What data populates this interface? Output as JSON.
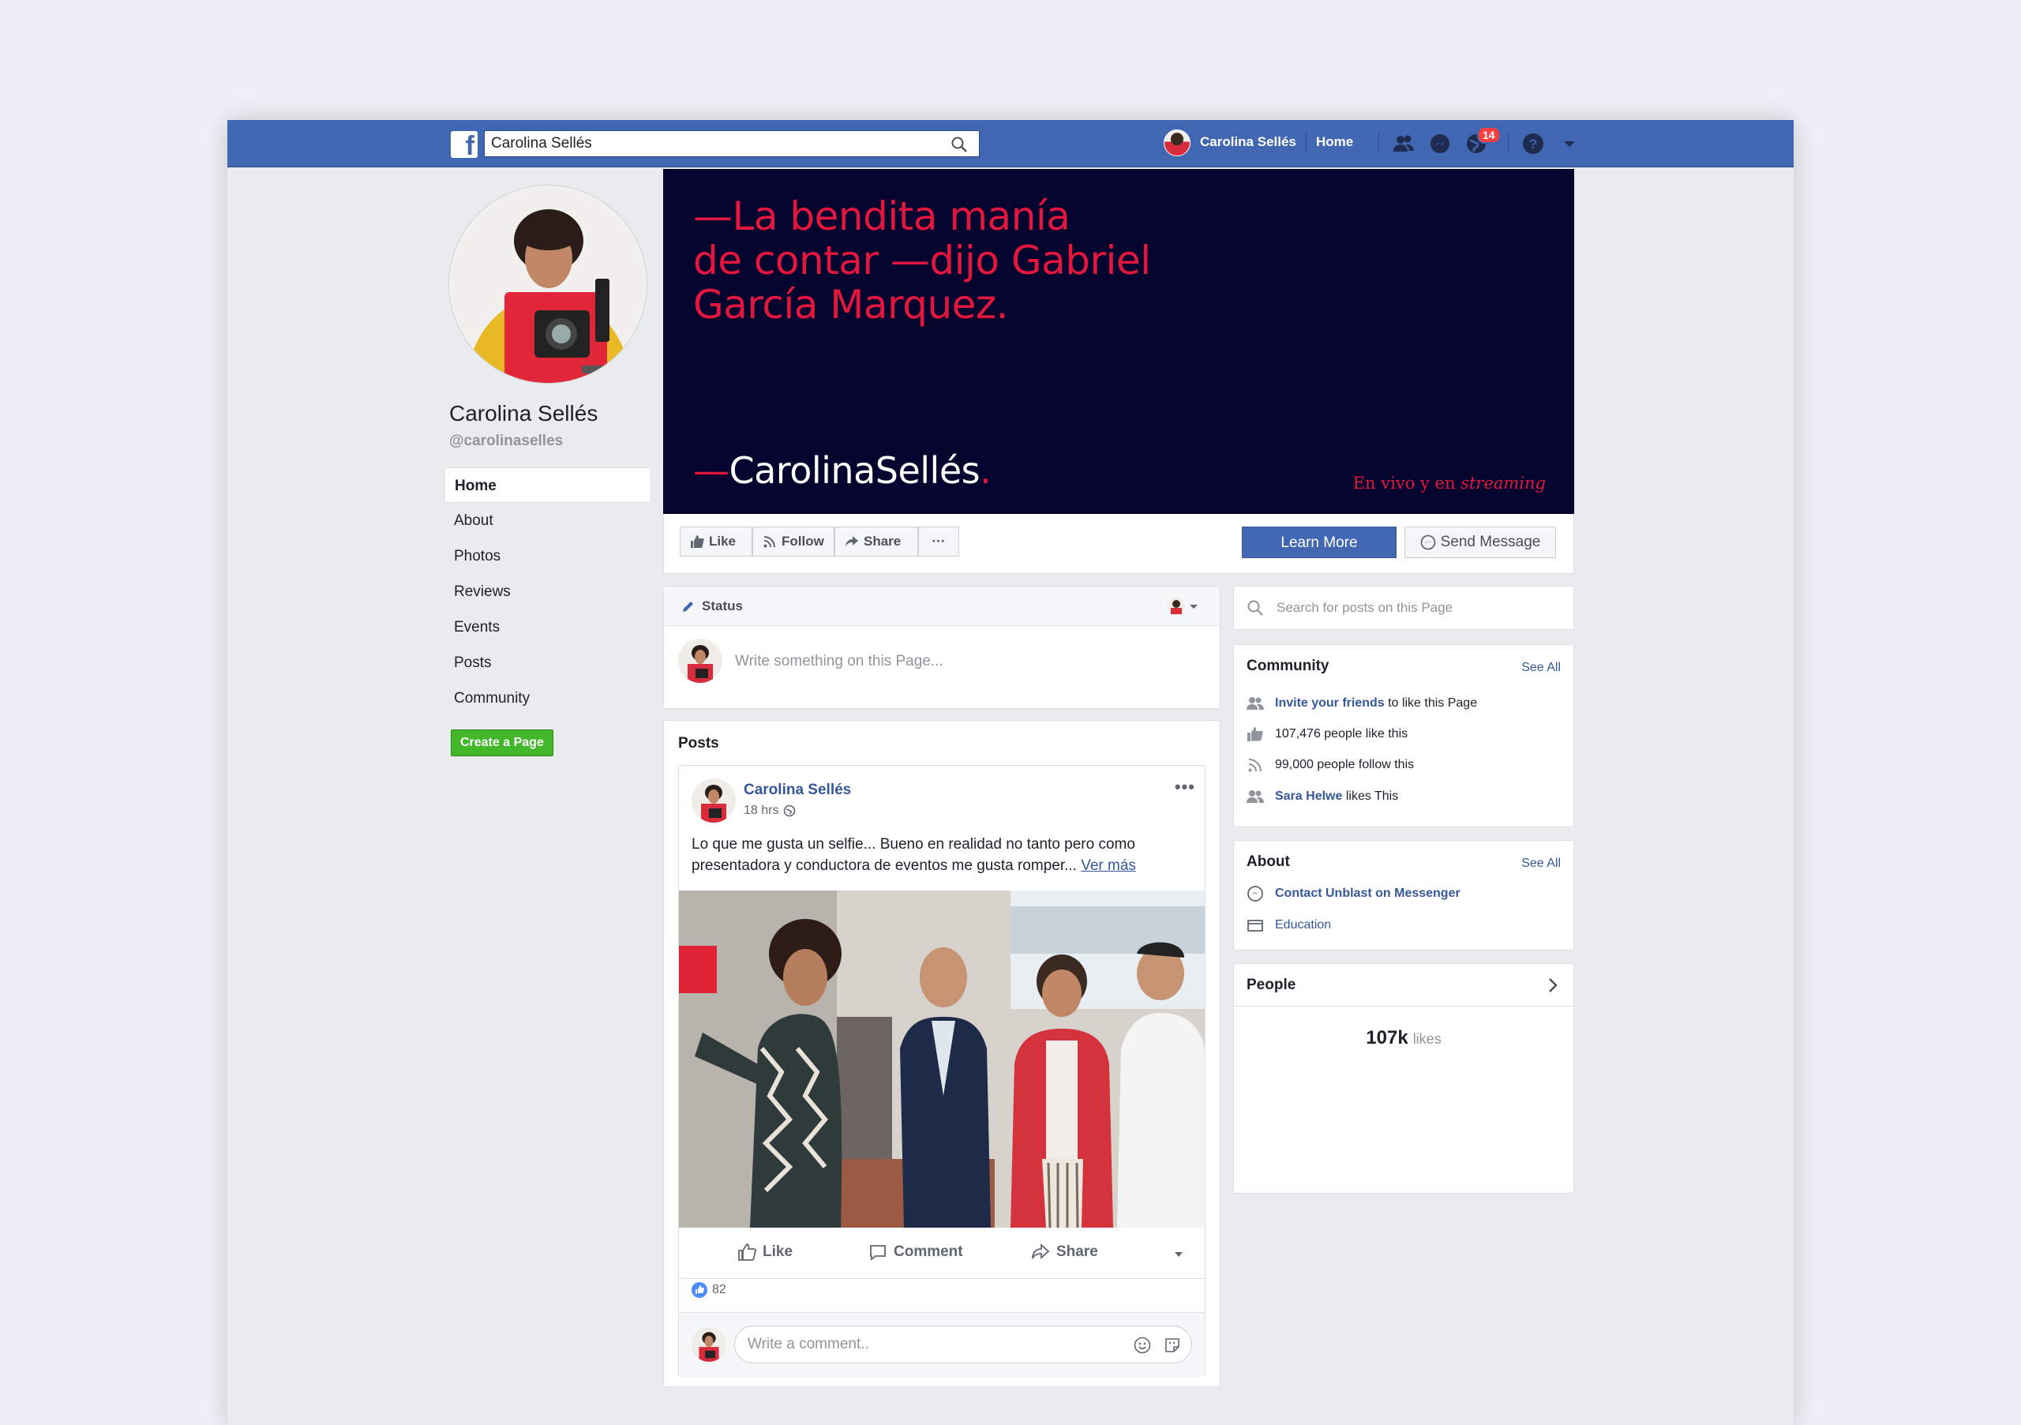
{
  "topbar": {
    "search_value": "Carolina Sellés",
    "user_name": "Carolina Sellés",
    "home_label": "Home",
    "notifications_count": "14"
  },
  "profile": {
    "name": "Carolina Sellés",
    "handle": "@carolinaselles"
  },
  "left_nav": {
    "items": [
      {
        "label": "Home"
      },
      {
        "label": "About"
      },
      {
        "label": "Photos"
      },
      {
        "label": "Reviews"
      },
      {
        "label": "Events"
      },
      {
        "label": "Posts"
      },
      {
        "label": "Community"
      }
    ],
    "create_page_label": "Create a Page"
  },
  "cover": {
    "quote_lines": [
      "—La bendita manía",
      "de contar —dijo Gabriel",
      "García Marquez."
    ],
    "brand_dash": "—",
    "brand_name": "CarolinaSellés",
    "brand_dot": ".",
    "tagline_prefix": "En vivo y en ",
    "tagline_italic": "streaming"
  },
  "actions": {
    "like_label": "Like",
    "follow_label": "Follow",
    "share_label": "Share",
    "more_label": "···",
    "learn_more_label": "Learn More",
    "send_message_label": "Send Message"
  },
  "composer": {
    "status_label": "Status",
    "placeholder": "Write something on this Page..."
  },
  "posts": {
    "title": "Posts",
    "post": {
      "author": "Carolina Sellés",
      "time": "18 hrs",
      "text": "Lo que me gusta un selfie... Bueno en realidad no tanto pero como presentadora y conductora de eventos me gusta romper... ",
      "see_more": "Ver más",
      "like_label": "Like",
      "comment_label": "Comment",
      "share_label": "Share",
      "reactions_count": "82",
      "comment_placeholder": "Write a comment.."
    }
  },
  "right": {
    "search_placeholder": "Search for posts on this Page",
    "community": {
      "title": "Community",
      "see_all": "See All",
      "invite_link": "Invite your friends",
      "invite_rest": " to like this Page",
      "likes": "107,476 people like this",
      "follows": "99,000 people follow this",
      "friend_link": "Sara Helwe",
      "friend_rest": " likes This"
    },
    "about": {
      "title": "About",
      "see_all": "See All",
      "messenger": "Contact Unblast on Messenger",
      "education": "Education"
    },
    "people": {
      "title": "People",
      "count": "107k",
      "count_label": "likes"
    }
  },
  "colors": {
    "facebook_blue": "#4267b2",
    "link_blue": "#365899",
    "cover_bg": "#04042e",
    "brand_red": "#e3173e",
    "create_green": "#42b72a"
  }
}
